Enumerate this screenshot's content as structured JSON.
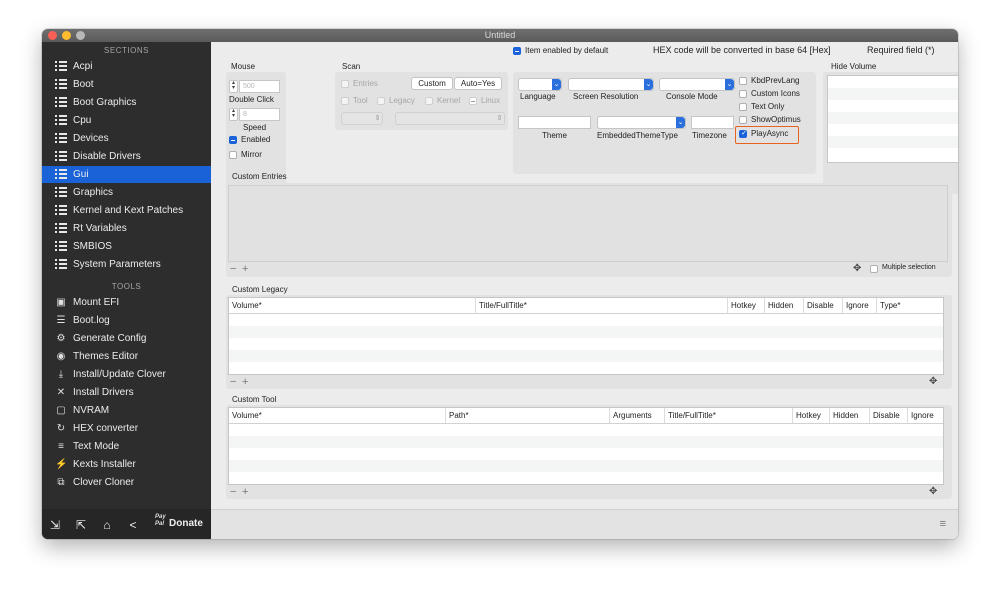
{
  "window": {
    "title": "Untitled"
  },
  "sidebar": {
    "sections_heading": "SECTIONS",
    "tools_heading": "TOOLS",
    "sections": [
      {
        "label": "Acpi",
        "icon": "list-icon"
      },
      {
        "label": "Boot",
        "icon": "list-icon"
      },
      {
        "label": "Boot Graphics",
        "icon": "list-icon"
      },
      {
        "label": "Cpu",
        "icon": "list-icon"
      },
      {
        "label": "Devices",
        "icon": "list-icon"
      },
      {
        "label": "Disable Drivers",
        "icon": "list-icon"
      },
      {
        "label": "Gui",
        "icon": "list-icon",
        "selected": true
      },
      {
        "label": "Graphics",
        "icon": "list-icon"
      },
      {
        "label": "Kernel and Kext Patches",
        "icon": "list-icon"
      },
      {
        "label": "Rt Variables",
        "icon": "list-icon"
      },
      {
        "label": "SMBIOS",
        "icon": "list-icon"
      },
      {
        "label": "System Parameters",
        "icon": "list-icon"
      }
    ],
    "tools": [
      {
        "label": "Mount EFI",
        "icon": "disk-icon"
      },
      {
        "label": "Boot.log",
        "icon": "log-search-icon"
      },
      {
        "label": "Generate Config",
        "icon": "gears-icon"
      },
      {
        "label": "Themes Editor",
        "icon": "palette-icon"
      },
      {
        "label": "Install/Update Clover",
        "icon": "download-icon"
      },
      {
        "label": "Install Drivers",
        "icon": "tools-icon"
      },
      {
        "label": "NVRAM",
        "icon": "chip-icon"
      },
      {
        "label": "HEX converter",
        "icon": "refresh-icon"
      },
      {
        "label": "Text Mode",
        "icon": "text-lines-icon"
      },
      {
        "label": "Kexts Installer",
        "icon": "plug-icon"
      },
      {
        "label": "Clover Cloner",
        "icon": "copy-icon"
      }
    ],
    "bottom": {
      "pay_line1": "Pay",
      "pay_line2": "Pal",
      "donate_label": "Donate"
    }
  },
  "header": {
    "item_enabled_default": "Item enabled by default",
    "hex_notice": "HEX code will be converted in base 64 [Hex]",
    "required_notice": "Required field (*)"
  },
  "mouse": {
    "title": "Mouse",
    "double_click_value": "500",
    "double_click_label": "Double Click",
    "speed_value": "8",
    "speed_label": "Speed",
    "enabled_label": "Enabled",
    "mirror_label": "Mirror"
  },
  "scan": {
    "title": "Scan",
    "entries_label": "Entries",
    "custom_button": "Custom",
    "auto_button": "Auto=Yes",
    "tool_label": "Tool",
    "legacy_label": "Legacy",
    "kernel_label": "Kernel",
    "linux_label": "Linux"
  },
  "options": {
    "language_label": "Language",
    "screen_resolution_label": "Screen Resolution",
    "console_mode_label": "Console Mode",
    "theme_label": "Theme",
    "embedded_theme_label": "EmbeddedThemeType",
    "timezone_label": "Timezone",
    "kbd_prev_lang": "KbdPrevLang",
    "custom_icons": "Custom Icons",
    "text_only": "Text Only",
    "show_optimus": "ShowOptimus",
    "play_async": "PlayAsync"
  },
  "hide_volume": {
    "title": "Hide Volume"
  },
  "custom_entries": {
    "title": "Custom Entries",
    "multiple_selection": "Multiple selection"
  },
  "custom_legacy": {
    "title": "Custom Legacy",
    "columns": [
      "Volume*",
      "Title/FullTitle*",
      "Hotkey",
      "Hidden",
      "Disable",
      "Ignore",
      "Type*"
    ]
  },
  "custom_tool": {
    "title": "Custom Tool",
    "columns": [
      "Volume*",
      "Path*",
      "Arguments",
      "Title/FullTitle*",
      "Hotkey",
      "Hidden",
      "Disable",
      "Ignore"
    ]
  },
  "colors": {
    "accent": "#1a62d8",
    "highlight": "#e8641e",
    "sidebar_bg": "#2d2d2d"
  }
}
